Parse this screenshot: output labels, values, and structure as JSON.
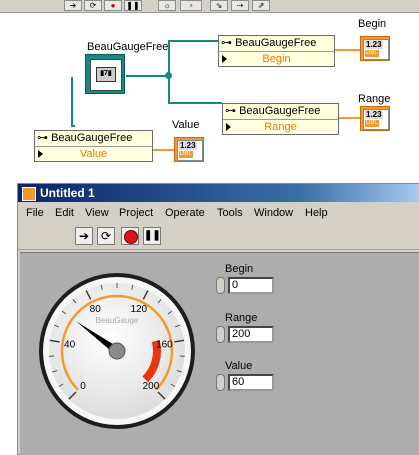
{
  "block_diagram": {
    "beaugaugefree_ref_label": "BeauGaugeFree",
    "node_begin": {
      "class_label": "BeauGaugeFree",
      "property": "Begin"
    },
    "node_range": {
      "class_label": "BeauGaugeFree",
      "property": "Range"
    },
    "node_value": {
      "class_label": "BeauGaugeFree",
      "property": "Value"
    },
    "ind_begin": {
      "label": "Begin",
      "num": "1.23",
      "type": "DBL"
    },
    "ind_range": {
      "label": "Range",
      "num": "1.23",
      "type": "DBL"
    },
    "ctl_value": {
      "label": "Value",
      "num": "1.23",
      "type": "DBL"
    }
  },
  "window": {
    "title": "Untitled 1",
    "menu": [
      "File",
      "Edit",
      "View",
      "Project",
      "Operate",
      "Tools",
      "Window",
      "Help"
    ]
  },
  "front_panel": {
    "gauge": {
      "caption": "BeauGauge",
      "ticks": [
        "0",
        "40",
        "80",
        "120",
        "160",
        "200"
      ],
      "begin": 0,
      "range": 200,
      "value": 60
    },
    "begin": {
      "label": "Begin",
      "value": "0"
    },
    "range": {
      "label": "Range",
      "value": "200"
    },
    "value": {
      "label": "Value",
      "value": "60"
    }
  },
  "colors": {
    "wire_ref": "#138a86",
    "wire_dbl": "#f29a2e",
    "needle": "#000000",
    "arc": "#f29a2e",
    "red_zone": "#e8350e"
  }
}
